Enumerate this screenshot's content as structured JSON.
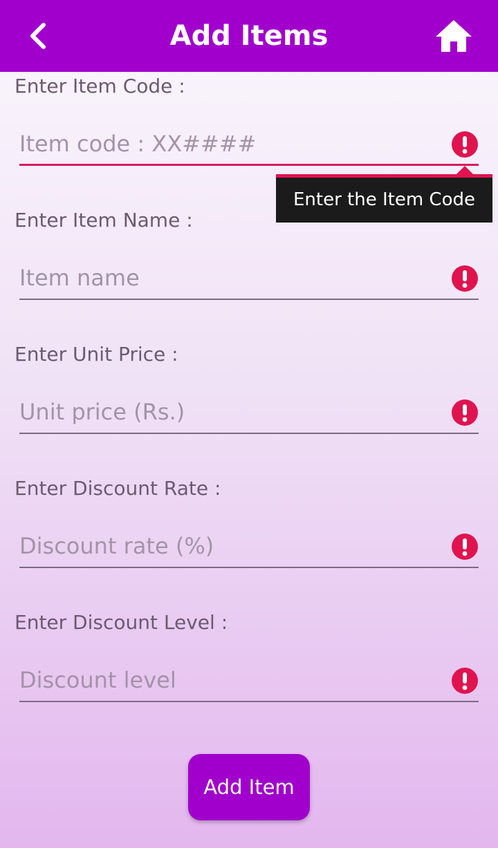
{
  "appbar": {
    "title": "Add Items",
    "back_icon": "chevron-left-icon",
    "home_icon": "home-icon",
    "color": "#a100cc"
  },
  "fields": [
    {
      "label": "Enter Item Code :",
      "placeholder": "Item code : XX####",
      "value": "",
      "error": true
    },
    {
      "label": "Enter Item Name :",
      "placeholder": "Item name",
      "value": "",
      "error": true
    },
    {
      "label": "Enter Unit Price :",
      "placeholder": "Unit price (Rs.)",
      "value": "",
      "error": true
    },
    {
      "label": "Enter Discount Rate :",
      "placeholder": "Discount rate (%)",
      "value": "",
      "error": true
    },
    {
      "label": "Enter Discount Level :",
      "placeholder": "Discount level",
      "value": "",
      "error": true
    }
  ],
  "error_tooltip": {
    "text": "Enter the Item Code",
    "icon": "error-icon",
    "accent": "#e0134f"
  },
  "submit": {
    "label": "Add Item"
  }
}
